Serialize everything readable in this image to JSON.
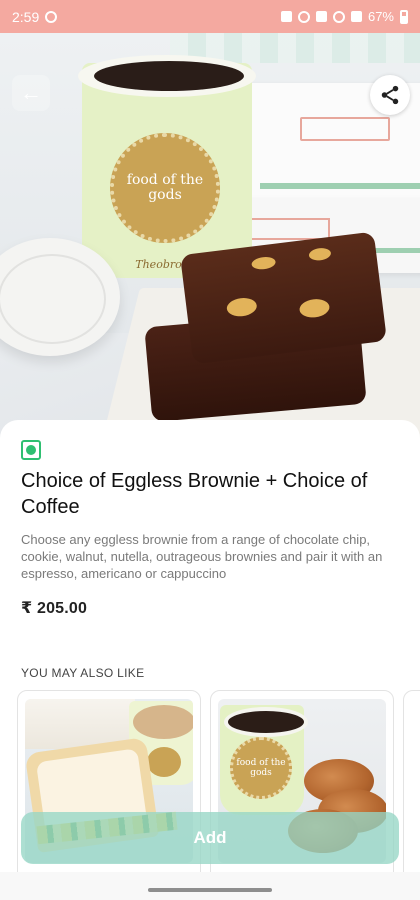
{
  "status_bar": {
    "time": "2:59",
    "battery": "67%"
  },
  "header": {
    "back_label": "←"
  },
  "product": {
    "veg_indicator": "veg",
    "title": "Choice of Eggless Brownie + Choice of Coffee",
    "description": "Choose any eggless brownie from a range of chocolate chip, cookie, walnut, nutella, outrageous brownies and pair it with an espresso, americano or cappuccino",
    "price": "₹ 205.00"
  },
  "hero_image": {
    "cup_seal_text": "food of the gods",
    "cup_brand_text": "Theobroma"
  },
  "recommendations": {
    "heading": "YOU MAY ALSO LIKE",
    "items": [
      {
        "image": "sandwich-and-latte"
      },
      {
        "image": "coffee-and-croissants",
        "seal_text": "food of the gods"
      }
    ]
  },
  "actions": {
    "add_label": "Add"
  },
  "colors": {
    "status_bar": "#f4a9a0",
    "veg_green": "#2fbf71",
    "add_button": "#96d6c5"
  },
  "icons": [
    "back-arrow-icon",
    "share-icon",
    "veg-indicator-icon"
  ]
}
